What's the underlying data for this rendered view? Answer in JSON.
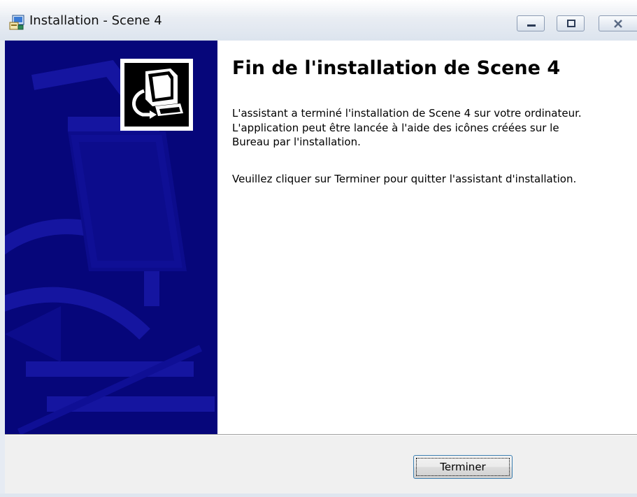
{
  "window": {
    "title": "Installation - Scene 4",
    "icon": "installer-icon",
    "controls": {
      "minimize": "minimize-icon",
      "maximize": "maximize-icon",
      "close": "close-icon"
    }
  },
  "banner": {
    "logo_icon": "computer-install-icon",
    "background_color": "#06067a"
  },
  "main": {
    "heading": "Fin de l'installation de Scene 4",
    "paragraph1": "L'assistant a terminé l'installation de Scene 4 sur votre ordinateur. L'application peut être lancée à l'aide des icônes créées sur le Bureau par l'installation.",
    "paragraph2": "Veuillez cliquer sur Terminer pour quitter l'assistant d'installation."
  },
  "footer": {
    "finish_label": "Terminer"
  }
}
